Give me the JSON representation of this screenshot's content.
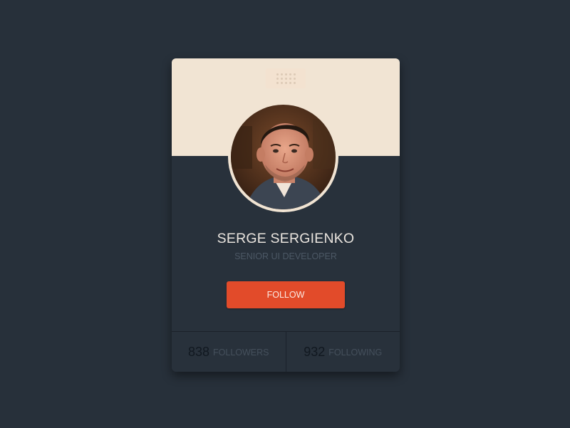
{
  "profile": {
    "name": "SERGE SERGIENKO",
    "title": "SENIOR UI DEVELOPER",
    "follow_label": "FOLLOW"
  },
  "stats": [
    {
      "value": "838",
      "label": "FOLLOWERS"
    },
    {
      "value": "932",
      "label": "FOLLOWING"
    }
  ],
  "colors": {
    "background": "#27303a",
    "card": "#28313b",
    "cover": "#f1e4d3",
    "accent": "#e24b2a",
    "name_text": "#e9e4de",
    "muted_text": "#4c5865"
  },
  "icons": {
    "grip": "drag-handle-icon"
  }
}
